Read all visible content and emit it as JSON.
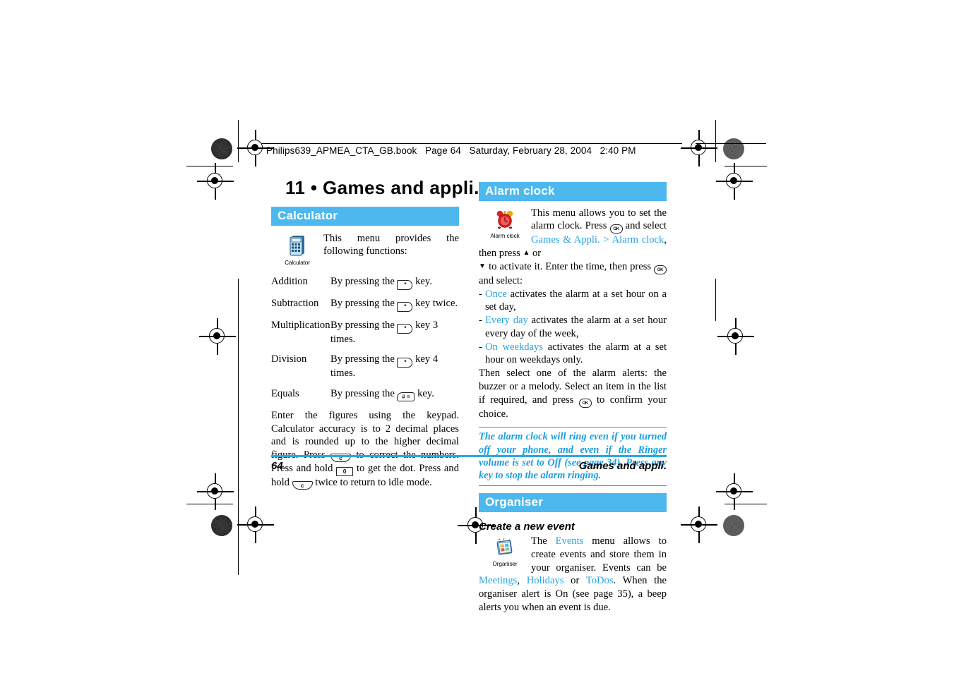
{
  "header": {
    "file_line": "Philips639_APMEA_CTA_GB.book   Page 64   Saturday, February 28, 2004   2:40 PM"
  },
  "chapter": {
    "title": "11 • Games and appli."
  },
  "sections": {
    "calculator": {
      "bar_label": "Calculator",
      "icon_caption": "Calculator",
      "icon_name": "calculator-icon",
      "intro": "This menu provides the following functions:",
      "rows": [
        {
          "term": "Addition",
          "pre": "By pressing the",
          "key": "star",
          "post": "key."
        },
        {
          "term": "Subtraction",
          "pre": "By pressing the",
          "key": "star",
          "post": "key twice."
        },
        {
          "term": "Multiplication",
          "pre": "By pressing the",
          "key": "star",
          "post": "key 3 times."
        },
        {
          "term": "Division",
          "pre": "By pressing the",
          "key": "star",
          "post": "key 4 times."
        },
        {
          "term": "Equals",
          "pre": "By pressing the",
          "key": "hash",
          "post": "key."
        }
      ],
      "body_1": "Enter the figures using the keypad. Calculator accuracy is to 2 decimal places and is rounded up to the higher decimal figure. Press",
      "body_2": "to correct the numbers. Press and hold",
      "body_3": "to get the dot. Press and hold",
      "body_4": "twice to return to idle mode."
    },
    "alarm_clock": {
      "bar_label": "Alarm clock",
      "icon_caption": "Alarm clock",
      "icon_name": "alarm-clock-icon",
      "intro_1": "This menu allows you to set the alarm clock. Press",
      "intro_2": "and select",
      "link_games_appli": "Games & Appli.",
      "separator": ">",
      "link_alarm_clock": "Alarm clock",
      "intro_3": ", then press",
      "intro_4": "or",
      "intro_5": "to activate it. Enter the time, then press",
      "intro_6": "and select:",
      "options": [
        {
          "term": "Once",
          "text": "activates the alarm at a set hour on a set day,"
        },
        {
          "term": "Every day",
          "text": "activates the alarm at a set hour every day of the week,"
        },
        {
          "term": "On weekdays",
          "text": "activates the alarm at a set hour on weekdays only."
        }
      ],
      "after_1": "Then select one of the alarm alerts: the buzzer or a melody. Select an item in the list if required, and press",
      "after_2": "to confirm your choice.",
      "note_1": "The alarm clock will ring even if you turned off your phone, and even if the Ringer volume is set to",
      "note_off": "Off",
      "note_2": "(see page 34). Press any key to stop the alarm ringing."
    },
    "organiser": {
      "bar_label": "Organiser",
      "subhead": "Create a new event",
      "icon_caption": "Organiser",
      "icon_name": "organiser-icon",
      "text_1": "The",
      "link_events": "Events",
      "text_2": "menu allows to create events and store them in your organiser. Events can be",
      "link_meetings": "Meetings",
      "comma": ",",
      "link_holidays": "Holidays",
      "text_3": "or",
      "link_todos": "ToDos",
      "text_4": ". When the organiser alert is On (see page 35), a beep alerts you when an event is due."
    }
  },
  "keys": {
    "star": "*",
    "hash": "# =",
    "clear": "c",
    "zero": "0",
    "ok": "OK",
    "up": "▲",
    "down": "▼"
  },
  "footer": {
    "page_number": "64",
    "running_title": "Games and appli."
  },
  "colors": {
    "accent_bar": "#4db8ee",
    "link": "#29a3e3",
    "note": "#1a9ee0",
    "footer_rule": "#2ba7e6"
  }
}
